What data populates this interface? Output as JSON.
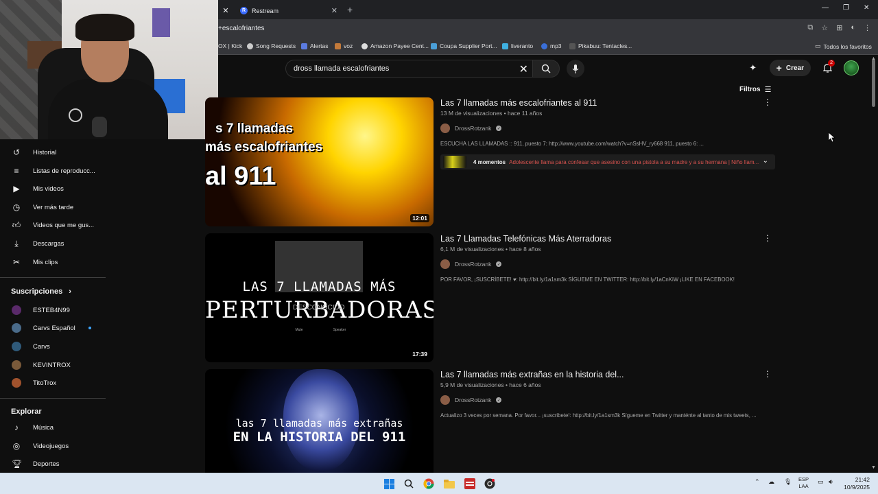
{
  "browser": {
    "tabs": [
      {
        "label": ""
      },
      {
        "label": "Restream"
      }
    ],
    "address": "+escalofriantes",
    "bookmarks": [
      {
        "label": "OX | Kick"
      },
      {
        "label": "Song Requests"
      },
      {
        "label": "Alertas"
      },
      {
        "label": "voz"
      },
      {
        "label": "Amazon Payee Cent..."
      },
      {
        "label": "Coupa Supplier Port..."
      },
      {
        "label": "liveranto"
      },
      {
        "label": "mp3"
      },
      {
        "label": "Pikabuu: Tentacles..."
      }
    ],
    "all_bookmarks": "Todos los favoritos"
  },
  "header": {
    "search_query": "dross llamada escalofriantes",
    "create_label": "Crear",
    "notification_count": "2"
  },
  "filters_label": "Filtros",
  "sidebar": {
    "you_items": [
      {
        "label": "Historial",
        "icon": "history-icon"
      },
      {
        "label": "Listas de reproducc...",
        "icon": "playlist-icon"
      },
      {
        "label": "Mis videos",
        "icon": "my-videos-icon"
      },
      {
        "label": "Ver más tarde",
        "icon": "clock-icon"
      },
      {
        "label": "Videos que me gus...",
        "icon": "thumbs-up-icon"
      },
      {
        "label": "Descargas",
        "icon": "download-icon"
      },
      {
        "label": "Mis clips",
        "icon": "scissors-icon"
      }
    ],
    "subscriptions_heading": "Suscripciones",
    "subscriptions": [
      {
        "label": "ESTEB4N99",
        "color": "#5a2a6a"
      },
      {
        "label": "Carvs Español",
        "color": "#4a6b8a"
      },
      {
        "label": "Carvs",
        "color": "#2f5a7a"
      },
      {
        "label": "KEVINTROX",
        "color": "#7a5a3a"
      },
      {
        "label": "TitoTrox",
        "color": "#a0522d"
      }
    ],
    "explore_heading": "Explorar",
    "explore": [
      {
        "label": "Música",
        "icon": "music-icon"
      },
      {
        "label": "Videojuegos",
        "icon": "gamepad-icon"
      },
      {
        "label": "Deportes",
        "icon": "trophy-icon"
      }
    ]
  },
  "results": [
    {
      "title": "Las 7 llamadas más escalofriantes al 911",
      "stats": "13 M de visualizaciones • hace 11 años",
      "channel": "DrossRotzank",
      "description": "ESCUCHA LAS LLAMADAS :: 911, puesto 7: http://www.youtube.com/watch?v=nSsHV_ry668 911, puesto 6: ...",
      "duration": "12:01",
      "thumb_lines": [
        "s 7 llamadas",
        "más escalofriantes",
        "al 911"
      ],
      "moments_label": "4 momentos",
      "moments_text": "Adolescente llama para confesar que asesino con una pistola a su madre y a su hermana | Niño llam..."
    },
    {
      "title": "Las 7 Llamadas Telefónicas Más Aterradoras",
      "stats": "6,1 M de visualizaciones • hace 8 años",
      "channel": "DrossRotzank",
      "description": "POR FAVOR, ¡SUSCRÍBETE! ♥: http://bit.ly/1a1sm3k SÍGUEME EN TWITTER: http://bit.ly/1aCnKiW ¡LIKE EN FACEBOOK!",
      "duration": "17:39",
      "thumb_lines": [
        "LAS 7 LLAMADAS MÁS",
        "PERTURBADORAS"
      ],
      "thumb_overlay": "DESCONOCIDO",
      "thumb_controls": [
        "Mute",
        "Speaker"
      ]
    },
    {
      "title": "Las 7 llamadas más extrañas en la historia del...",
      "stats": "5,9 M de visualizaciones • hace 6 años",
      "channel": "DrossRotzank",
      "description": "Actualizo 3 veces por semana. Por favor... ¡suscribete!: http://bit.ly/1a1sm3k Sígueme en Twitter y manténte al tanto de mis tweets, ...",
      "thumb_lines": [
        "las 7 llamadas más extrañas",
        "EN LA HISTORIA DEL 911"
      ]
    }
  ],
  "taskbar": {
    "lang_top": "ESP",
    "lang_bottom": "LAA",
    "time": "21:42",
    "date": "10/9/2025"
  }
}
